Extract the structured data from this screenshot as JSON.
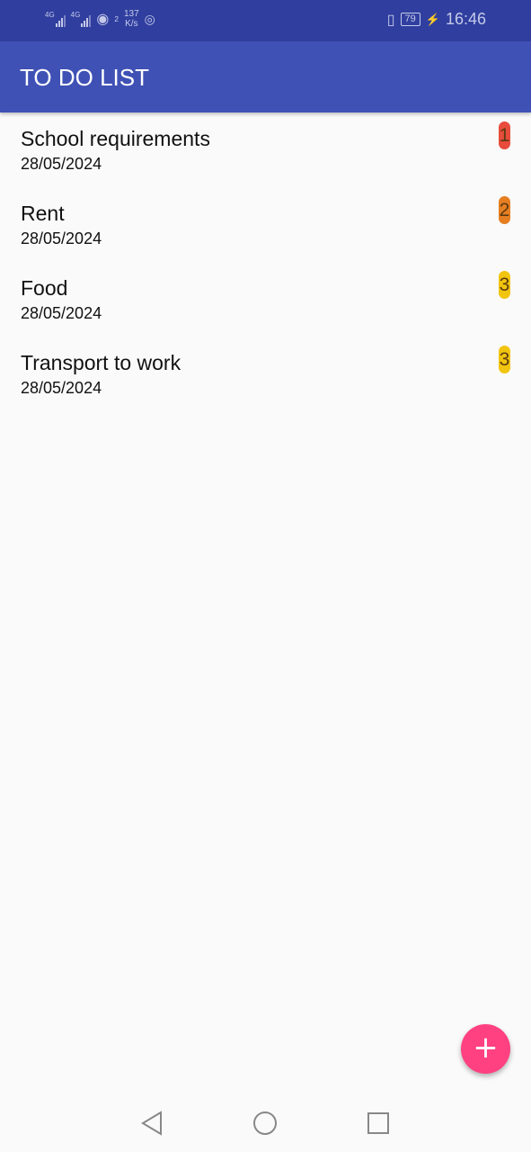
{
  "status_bar": {
    "signal1_label": "4G",
    "signal2_label": "4G",
    "hotspot_count": "2",
    "net_speed_value": "137",
    "net_speed_unit": "K/s",
    "battery": "79",
    "time": "16:46"
  },
  "app_bar": {
    "title": "TO DO LIST"
  },
  "items": [
    {
      "title": "School requirements",
      "date": "28/05/2024",
      "priority": "1",
      "color": "#e74c3c"
    },
    {
      "title": "Rent",
      "date": "28/05/2024",
      "priority": "2",
      "color": "#e67e22"
    },
    {
      "title": "Food",
      "date": "28/05/2024",
      "priority": "3",
      "color": "#f1c40f"
    },
    {
      "title": "Transport to work",
      "date": "28/05/2024",
      "priority": "3",
      "color": "#f1c40f"
    }
  ],
  "fab": {
    "icon": "plus-icon",
    "label": "+",
    "color": "#ff4081"
  },
  "colors": {
    "primary": "#3f51b5",
    "primary_dark": "#303f9f"
  }
}
